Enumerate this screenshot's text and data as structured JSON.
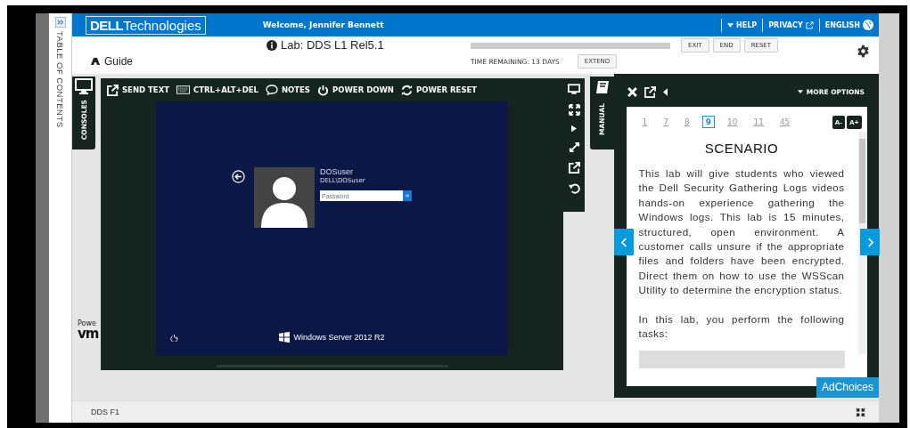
{
  "sidebar": {
    "label": "TABLE OF CONTENTS"
  },
  "header": {
    "brand": "DELL",
    "brand_suffix": "Technologies",
    "welcome": "Welcome, Jennifer Bennett",
    "nav": [
      {
        "label": "HELP",
        "kind": "dropdown"
      },
      {
        "label": "PRIVACY",
        "kind": "external"
      },
      {
        "label": "ENGLISH",
        "kind": "globe"
      }
    ]
  },
  "lab": {
    "title": "Lab: DDS L1 Rel5.1",
    "guide": "Guide",
    "time_remaining": "TIME REMAINING: 13 DAYS",
    "buttons": [
      "EXIT",
      "END",
      "RESET"
    ],
    "extend": "EXTEND"
  },
  "console": {
    "tab": "CONSOLES",
    "toolbar": [
      {
        "label": "SEND TEXT",
        "kind": "send"
      },
      {
        "label": "CTRL+ALT+DEL",
        "kind": "keyboard"
      },
      {
        "label": "NOTES",
        "kind": "notes"
      },
      {
        "label": "POWER DOWN",
        "kind": "power"
      },
      {
        "label": "POWER RESET",
        "kind": "reset"
      }
    ],
    "screen": {
      "user": "DOSuser",
      "domain": "DELL\\DOSuser",
      "placeholder": "Password",
      "os": "Windows Server 2012 R2"
    }
  },
  "vendor": {
    "line_1": "Powe",
    "line_2": "vm"
  },
  "manual": {
    "tab": "MANUAL",
    "more_options": "MORE OPTIONS",
    "pages": [
      {
        "label": "1",
        "selected": false
      },
      {
        "label": "7",
        "selected": false
      },
      {
        "label": "8",
        "selected": false
      },
      {
        "label": "9",
        "selected": true
      },
      {
        "label": "10",
        "selected": false
      },
      {
        "label": "11",
        "selected": false
      },
      {
        "label": "45",
        "selected": false
      }
    ],
    "font_buttons": [
      "A-",
      "A+"
    ],
    "heading": "SCENARIO",
    "paragraphs": [
      "This lab will give students who viewed the Dell Security Gathering Logs videos hands-on experience gathering the Windows logs. This lab is 15 minutes, structured, open environment. A customer calls unsure if the appropriate files and folders have been encrypted. Direct them on how to use the WSScan Utility to determine the encryption status.",
      "In this lab, you perform the following tasks:"
    ],
    "adchoices": "AdChoices"
  },
  "footer": {
    "label": "DDS F1"
  }
}
